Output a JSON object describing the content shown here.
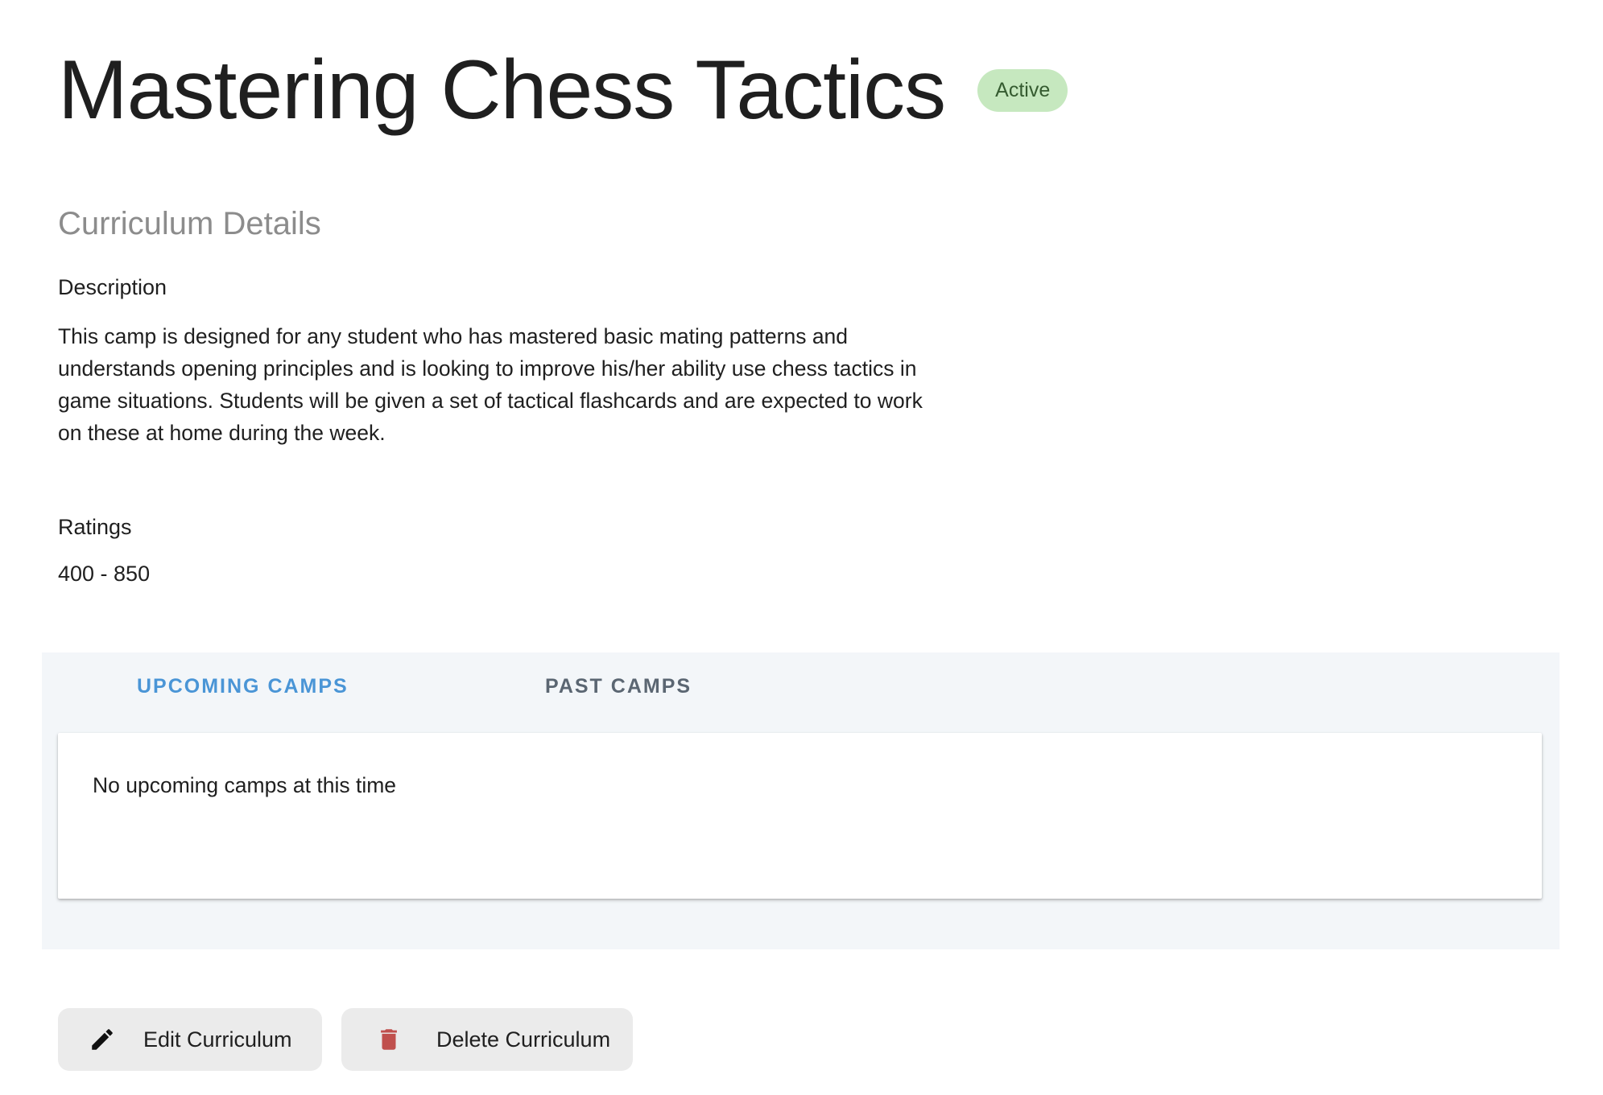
{
  "header": {
    "title": "Mastering Chess Tactics",
    "status": "Active",
    "status_color": "#c6e8bf"
  },
  "details": {
    "section_title": "Curriculum Details",
    "description_label": "Description",
    "description": "This camp is designed for any student who has mastered basic mating patterns and understands opening principles and is looking to improve his/her ability use chess tactics in game situations. Students will be given a set of tactical flashcards and are expected to work on these at home during the week.",
    "ratings_label": "Ratings",
    "ratings_value": "400 - 850"
  },
  "tabs": {
    "items": [
      {
        "label": "UPCOMING CAMPS",
        "active": true
      },
      {
        "label": "PAST CAMPS",
        "active": false
      }
    ],
    "active_color": "#4a95d6",
    "empty_message": "No upcoming camps at this time"
  },
  "actions": {
    "edit_label": "Edit Curriculum",
    "edit_icon": "pencil-icon",
    "delete_label": "Delete Curriculum",
    "delete_icon": "trash-icon",
    "delete_icon_color": "#c0504d"
  }
}
